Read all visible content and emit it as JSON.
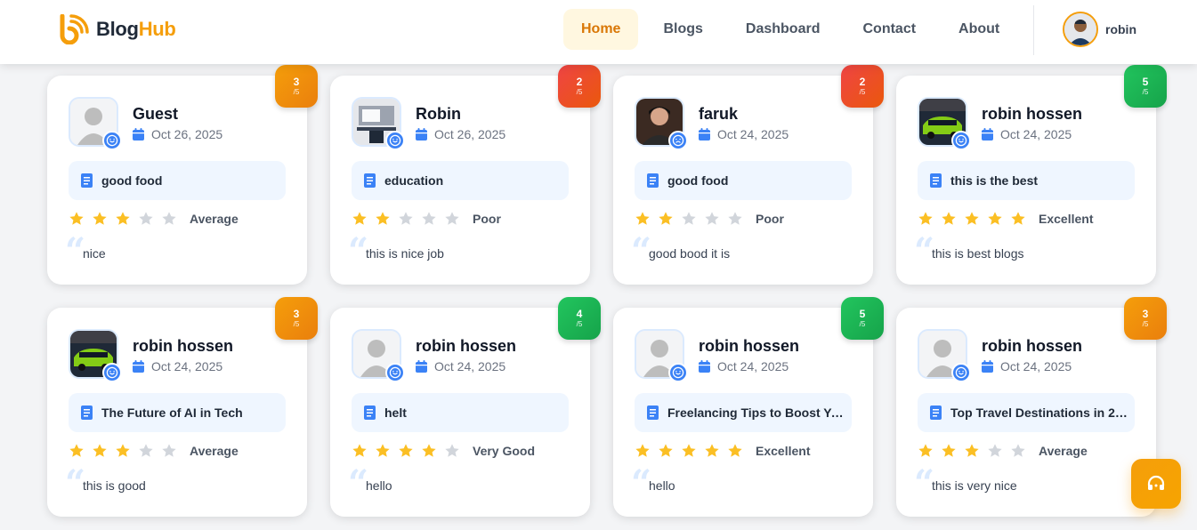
{
  "header": {
    "brand_part1": "Blog",
    "brand_part2": "Hub",
    "nav": [
      "Home",
      "Blogs",
      "Dashboard",
      "Contact",
      "About"
    ],
    "active_nav": "Home",
    "user_name": "robin"
  },
  "colors": {
    "accent": "#f59e0b",
    "blue": "#3b82f6",
    "star_on": "#fbbf24",
    "star_off": "#d1d5db",
    "score_orange": "#f59e0b",
    "score_red": "#ef4444",
    "score_green": "#22c55e"
  },
  "reviews": [
    {
      "score": "3",
      "score_denominator": "/5",
      "score_color": "orange",
      "name": "Guest",
      "date": "Oct 26, 2025",
      "avatar": "default-avatar",
      "mood_icon": "smile-icon",
      "blog": "good food",
      "stars": 3,
      "rating_label": "Average",
      "comment": "nice"
    },
    {
      "score": "2",
      "score_denominator": "/5",
      "score_color": "red",
      "name": "Robin",
      "date": "Oct 26, 2025",
      "avatar": "desk-photo",
      "mood_icon": "smile-icon",
      "blog": "education",
      "stars": 2,
      "rating_label": "Poor",
      "comment": "this is nice job"
    },
    {
      "score": "2",
      "score_denominator": "/5",
      "score_color": "red",
      "name": "faruk",
      "date": "Oct 24, 2025",
      "avatar": "person-photo",
      "mood_icon": "frown-icon",
      "blog": "good food",
      "stars": 2,
      "rating_label": "Poor",
      "comment": "good bood it is"
    },
    {
      "score": "5",
      "score_denominator": "/5",
      "score_color": "green",
      "name": "robin hossen",
      "date": "Oct 24, 2025",
      "avatar": "car-photo",
      "mood_icon": "smile-icon",
      "blog": "this is the best",
      "stars": 5,
      "rating_label": "Excellent",
      "comment": "this is best blogs"
    },
    {
      "score": "3",
      "score_denominator": "/5",
      "score_color": "orange",
      "name": "robin hossen",
      "date": "Oct 24, 2025",
      "avatar": "car-photo",
      "mood_icon": "smile-icon",
      "blog": "The Future of AI in Tech",
      "stars": 3,
      "rating_label": "Average",
      "comment": "this is good"
    },
    {
      "score": "4",
      "score_denominator": "/5",
      "score_color": "green",
      "name": "robin hossen",
      "date": "Oct 24, 2025",
      "avatar": "default-avatar",
      "mood_icon": "smile-icon",
      "blog": "helt",
      "stars": 4,
      "rating_label": "Very Good",
      "comment": "hello"
    },
    {
      "score": "5",
      "score_denominator": "/5",
      "score_color": "green",
      "name": "robin hossen",
      "date": "Oct 24, 2025",
      "avatar": "default-avatar",
      "mood_icon": "smile-icon",
      "blog": "Freelancing Tips to Boost Yo...",
      "stars": 5,
      "rating_label": "Excellent",
      "comment": "hello"
    },
    {
      "score": "3",
      "score_denominator": "/5",
      "score_color": "orange",
      "name": "robin hossen",
      "date": "Oct 24, 2025",
      "avatar": "default-avatar",
      "mood_icon": "smile-icon",
      "blog": "Top Travel Destinations in 20...",
      "stars": 3,
      "rating_label": "Average",
      "comment": "this is very nice"
    }
  ]
}
